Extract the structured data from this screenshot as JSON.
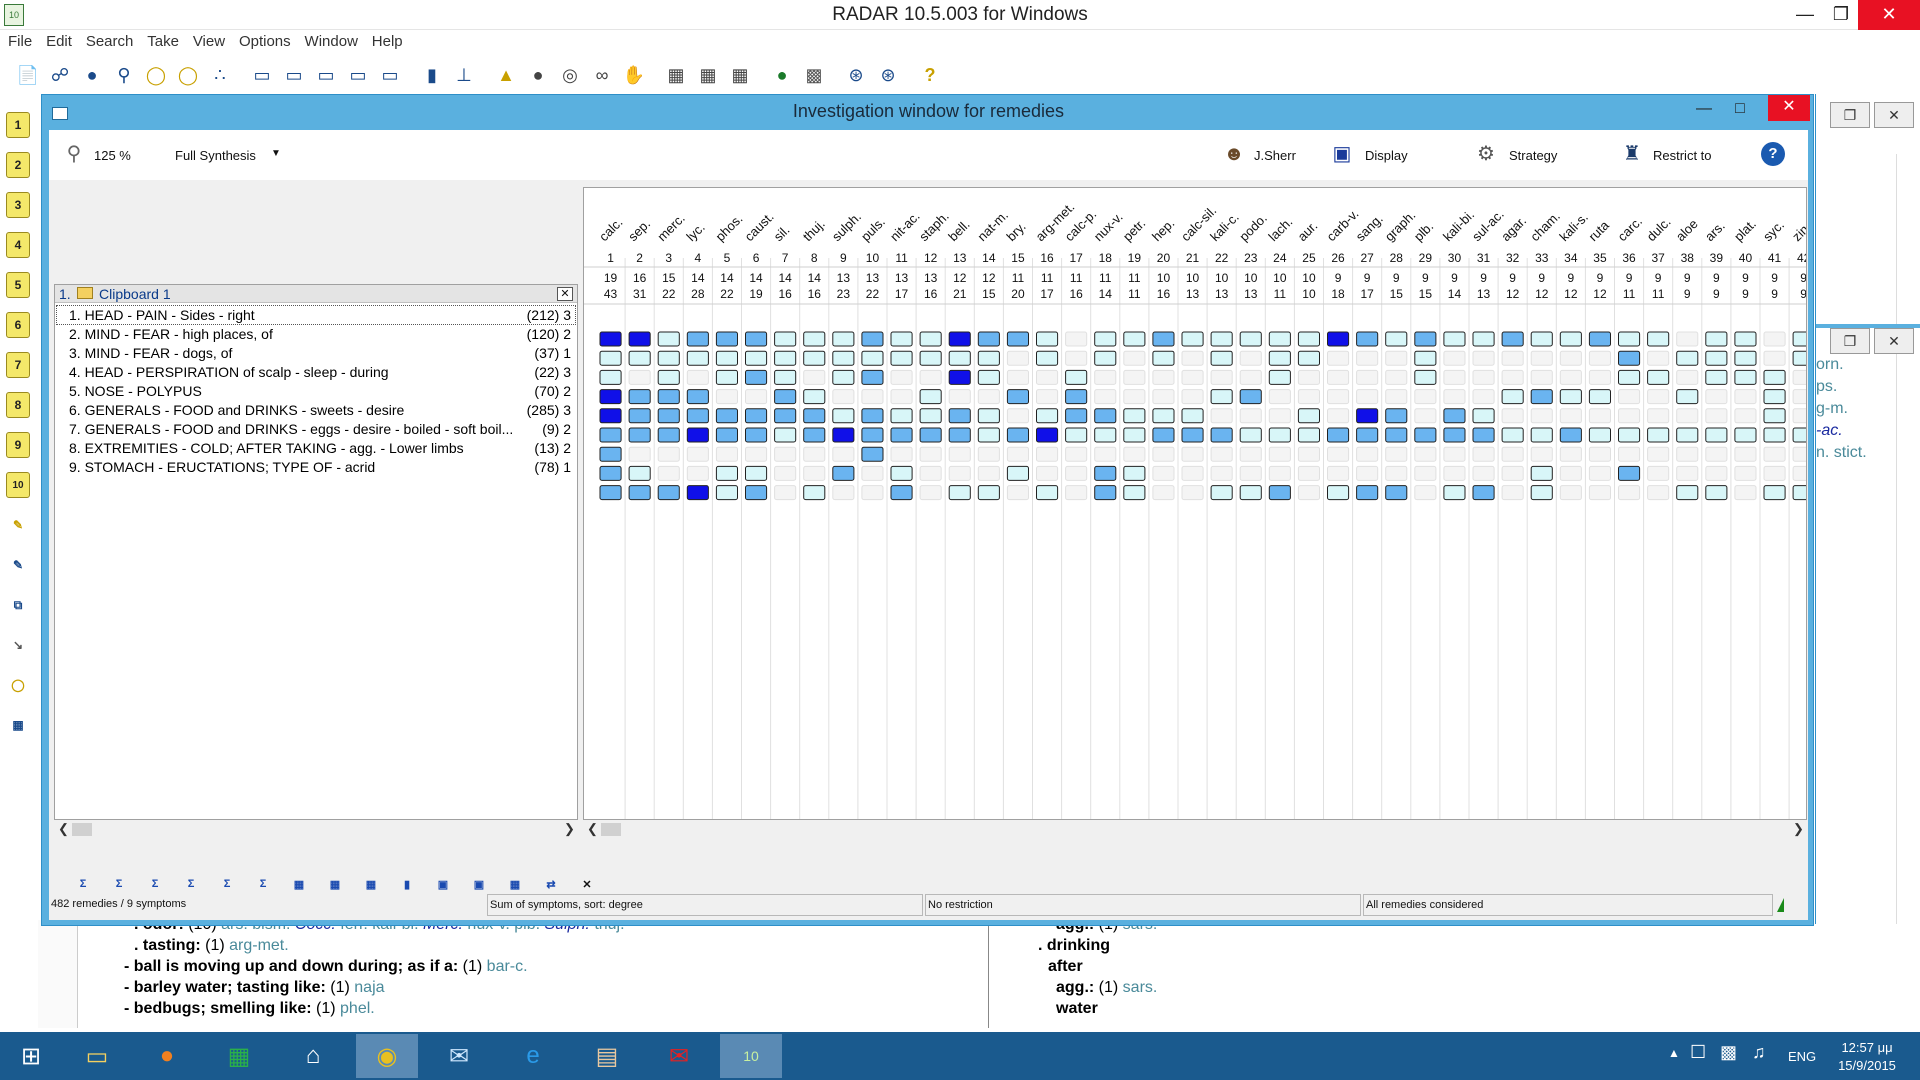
{
  "app": {
    "title": "RADAR 10.5.003 for Windows",
    "logo_text": "10 RADAR"
  },
  "menu": [
    "File",
    "Edit",
    "Search",
    "Take",
    "View",
    "Options",
    "Window",
    "Help"
  ],
  "toolbar_icons": [
    "open-icon",
    "binoculars-icon",
    "glasses-icon",
    "magnifier-icon",
    "bulb-icon",
    "bulb-plus-icon",
    "molecule-icon",
    "folder-icon",
    "folder-plus-icon",
    "folder-open-icon",
    "folder-edit-icon",
    "folder-star-icon",
    "bar-chart-icon",
    "tree-icon",
    "flame-icon",
    "shell-icon",
    "lifebuoy-icon",
    "spiral-icon",
    "hand-icon",
    "book-icon",
    "book-open-icon",
    "notes-icon",
    "globe-icon",
    "printer-icon",
    "network-icon",
    "network-plus-icon",
    "help-icon"
  ],
  "vtoolbar": [
    "1",
    "2",
    "3",
    "4",
    "5",
    "6",
    "7",
    "8",
    "9",
    "10"
  ],
  "investigation": {
    "title": "Investigation window for remedies",
    "zoom": "125 %",
    "method": "Full Synthesis",
    "author": "J.Sherr",
    "display_label": "Display",
    "strategy_label": "Strategy",
    "restrict_label": "Restrict to",
    "clipboard": {
      "number": "1.",
      "name": "Clipboard 1"
    },
    "symptoms": [
      {
        "text": "1. HEAD - PAIN - Sides - right",
        "count": "(212) 3"
      },
      {
        "text": "2. MIND - FEAR - high places, of",
        "count": "(120) 2"
      },
      {
        "text": "3. MIND - FEAR - dogs, of",
        "count": "(37) 1"
      },
      {
        "text": "4. HEAD - PERSPIRATION of scalp - sleep - during",
        "count": "(22) 3"
      },
      {
        "text": "5. NOSE - POLYPUS",
        "count": "(70) 2"
      },
      {
        "text": "6. GENERALS - FOOD and DRINKS - sweets - desire",
        "count": "(285) 3"
      },
      {
        "text": "7. GENERALS - FOOD and DRINKS - eggs - desire - boiled - soft boil...",
        "count": "(9) 2"
      },
      {
        "text": "8. EXTREMITIES - COLD; AFTER TAKING - agg. - Lower limbs",
        "count": "(13) 2"
      },
      {
        "text": "9. STOMACH - ERUCTATIONS; TYPE OF - acrid",
        "count": "(78) 1"
      }
    ],
    "remedies": [
      {
        "name": "calc.",
        "rank": "1",
        "s": "19",
        "d": "43"
      },
      {
        "name": "sep.",
        "rank": "2",
        "s": "16",
        "d": "31"
      },
      {
        "name": "merc.",
        "rank": "3",
        "s": "15",
        "d": "22"
      },
      {
        "name": "lyc.",
        "rank": "4",
        "s": "14",
        "d": "28"
      },
      {
        "name": "phos.",
        "rank": "5",
        "s": "14",
        "d": "22"
      },
      {
        "name": "caust.",
        "rank": "6",
        "s": "14",
        "d": "19"
      },
      {
        "name": "sil.",
        "rank": "7",
        "s": "14",
        "d": "16"
      },
      {
        "name": "thuj.",
        "rank": "8",
        "s": "14",
        "d": "16"
      },
      {
        "name": "sulph.",
        "rank": "9",
        "s": "13",
        "d": "23"
      },
      {
        "name": "puls.",
        "rank": "10",
        "s": "13",
        "d": "22"
      },
      {
        "name": "nit-ac.",
        "rank": "11",
        "s": "13",
        "d": "17"
      },
      {
        "name": "staph.",
        "rank": "12",
        "s": "13",
        "d": "16"
      },
      {
        "name": "bell.",
        "rank": "13",
        "s": "12",
        "d": "21"
      },
      {
        "name": "nat-m.",
        "rank": "14",
        "s": "12",
        "d": "15"
      },
      {
        "name": "bry.",
        "rank": "15",
        "s": "11",
        "d": "20"
      },
      {
        "name": "arg-met.",
        "rank": "16",
        "s": "11",
        "d": "17"
      },
      {
        "name": "calc-p.",
        "rank": "17",
        "s": "11",
        "d": "16"
      },
      {
        "name": "nux-v.",
        "rank": "18",
        "s": "11",
        "d": "14"
      },
      {
        "name": "petr.",
        "rank": "19",
        "s": "11",
        "d": "11"
      },
      {
        "name": "hep.",
        "rank": "20",
        "s": "10",
        "d": "16"
      },
      {
        "name": "calc-sil.",
        "rank": "21",
        "s": "10",
        "d": "13"
      },
      {
        "name": "kali-c.",
        "rank": "22",
        "s": "10",
        "d": "13"
      },
      {
        "name": "podo.",
        "rank": "23",
        "s": "10",
        "d": "13"
      },
      {
        "name": "lach.",
        "rank": "24",
        "s": "10",
        "d": "11"
      },
      {
        "name": "aur.",
        "rank": "25",
        "s": "10",
        "d": "10"
      },
      {
        "name": "carb-v.",
        "rank": "26",
        "s": "9",
        "d": "18"
      },
      {
        "name": "sang.",
        "rank": "27",
        "s": "9",
        "d": "17"
      },
      {
        "name": "graph.",
        "rank": "28",
        "s": "9",
        "d": "15"
      },
      {
        "name": "plb.",
        "rank": "29",
        "s": "9",
        "d": "15"
      },
      {
        "name": "kali-bi.",
        "rank": "30",
        "s": "9",
        "d": "14"
      },
      {
        "name": "sul-ac.",
        "rank": "31",
        "s": "9",
        "d": "13"
      },
      {
        "name": "agar.",
        "rank": "32",
        "s": "9",
        "d": "12"
      },
      {
        "name": "cham.",
        "rank": "33",
        "s": "9",
        "d": "12"
      },
      {
        "name": "kali-s.",
        "rank": "34",
        "s": "9",
        "d": "12"
      },
      {
        "name": "ruta",
        "rank": "35",
        "s": "9",
        "d": "12"
      },
      {
        "name": "carc.",
        "rank": "36",
        "s": "9",
        "d": "11"
      },
      {
        "name": "dulc.",
        "rank": "37",
        "s": "9",
        "d": "11"
      },
      {
        "name": "aloe",
        "rank": "38",
        "s": "9",
        "d": "9"
      },
      {
        "name": "ars.",
        "rank": "39",
        "s": "9",
        "d": "9"
      },
      {
        "name": "plat.",
        "rank": "40",
        "s": "9",
        "d": "9"
      },
      {
        "name": "syc.",
        "rank": "41",
        "s": "9",
        "d": "9"
      },
      {
        "name": "zin",
        "rank": "42",
        "s": "9",
        "d": "9"
      }
    ],
    "grades": [
      [
        3,
        3,
        1,
        2,
        2,
        2,
        1,
        1,
        1,
        2,
        1,
        1,
        3,
        2,
        2,
        1,
        0,
        1,
        1,
        2,
        1,
        1,
        1,
        1,
        1,
        3,
        2,
        1,
        2,
        1,
        1,
        2,
        1,
        1,
        2,
        1,
        1,
        0,
        1,
        1,
        0,
        1
      ],
      [
        1,
        1,
        1,
        1,
        1,
        1,
        1,
        1,
        1,
        1,
        1,
        1,
        1,
        1,
        0,
        1,
        0,
        1,
        0,
        1,
        0,
        1,
        0,
        1,
        1,
        0,
        0,
        0,
        1,
        0,
        0,
        0,
        0,
        0,
        0,
        2,
        0,
        1,
        1,
        1,
        0,
        1
      ],
      [
        1,
        0,
        1,
        0,
        1,
        2,
        1,
        0,
        1,
        2,
        0,
        0,
        3,
        1,
        0,
        0,
        1,
        0,
        0,
        0,
        0,
        0,
        0,
        1,
        0,
        0,
        0,
        0,
        1,
        0,
        0,
        0,
        0,
        0,
        0,
        1,
        1,
        0,
        1,
        1,
        1,
        0
      ],
      [
        3,
        2,
        2,
        2,
        0,
        0,
        2,
        1,
        0,
        0,
        0,
        1,
        0,
        0,
        2,
        0,
        2,
        0,
        0,
        0,
        0,
        1,
        2,
        0,
        0,
        0,
        0,
        0,
        0,
        0,
        0,
        1,
        2,
        1,
        1,
        0,
        0,
        1,
        0,
        0,
        1,
        0
      ],
      [
        3,
        2,
        2,
        2,
        2,
        2,
        2,
        2,
        1,
        2,
        1,
        1,
        2,
        1,
        0,
        1,
        2,
        2,
        1,
        1,
        1,
        0,
        0,
        0,
        1,
        0,
        3,
        2,
        0,
        2,
        1,
        0,
        0,
        0,
        0,
        0,
        0,
        0,
        0,
        0,
        1,
        0
      ],
      [
        2,
        2,
        2,
        3,
        2,
        2,
        1,
        2,
        3,
        2,
        2,
        2,
        2,
        1,
        2,
        3,
        1,
        1,
        1,
        2,
        2,
        2,
        1,
        1,
        1,
        2,
        2,
        2,
        2,
        2,
        2,
        1,
        1,
        2,
        1,
        1,
        1,
        1,
        1,
        1,
        1,
        1
      ],
      [
        2,
        0,
        0,
        0,
        0,
        0,
        0,
        0,
        0,
        2,
        0,
        0,
        0,
        0,
        0,
        0,
        0,
        0,
        0,
        0,
        0,
        0,
        0,
        0,
        0,
        0,
        0,
        0,
        0,
        0,
        0,
        0,
        0,
        0,
        0,
        0,
        0,
        0,
        0,
        0,
        0,
        0
      ],
      [
        2,
        1,
        0,
        0,
        1,
        1,
        0,
        0,
        2,
        0,
        1,
        0,
        0,
        0,
        1,
        0,
        0,
        2,
        1,
        0,
        0,
        0,
        0,
        0,
        0,
        0,
        0,
        0,
        0,
        0,
        0,
        0,
        1,
        0,
        0,
        2,
        0,
        0,
        0,
        0,
        0,
        0
      ],
      [
        2,
        2,
        2,
        3,
        1,
        2,
        0,
        1,
        0,
        0,
        2,
        0,
        1,
        1,
        0,
        1,
        0,
        2,
        1,
        0,
        0,
        1,
        1,
        2,
        0,
        1,
        2,
        2,
        0,
        1,
        2,
        0,
        1,
        0,
        0,
        0,
        0,
        1,
        1,
        0,
        1,
        1
      ]
    ],
    "colors": {
      "grade0": "#f4f4f4",
      "grade1": "#d8f6f8",
      "grade2": "#6ab4f0",
      "grade3": "#1010e8"
    },
    "bottom_tools": [
      "Σ",
      "Σ",
      "Σ",
      "Σ",
      "Σ",
      "Σ",
      "▦",
      "▦",
      "▦",
      "▮",
      "▣",
      "▣",
      "▦",
      "⇄",
      "✕"
    ],
    "status": {
      "count": "482 remedies / 9 symptoms",
      "sort": "Sum of symptoms, sort: degree",
      "restriction": "No restriction",
      "considered": "All remedies considered"
    }
  },
  "background_doc": {
    "left": [
      {
        "label": ". odor:",
        "count": "(10)",
        "rems": [
          "ars.",
          "bism.",
          "Cocc.",
          "ferr.",
          "kali-bi.",
          "Merc.",
          "nux-v.",
          "plb.",
          "Sulph.",
          "thuj."
        ]
      },
      {
        "label": ". tasting:",
        "count": "(1)",
        "rems": [
          "arg-met."
        ]
      },
      {
        "label": "- ball is moving up and down during; as if a:",
        "count": "(1)",
        "rems": [
          "bar-c."
        ]
      },
      {
        "label": "- barley water; tasting like:",
        "count": "(1)",
        "rems": [
          "naja"
        ]
      },
      {
        "label": "- bedbugs; smelling like:",
        "count": "(1)",
        "rems": [
          "phel."
        ]
      }
    ],
    "right": [
      {
        "label": "agg.:",
        "count": "(1)",
        "rems": [
          "sars."
        ]
      },
      {
        "label": ". drinking",
        "count": "",
        "rems": []
      },
      {
        "label": "after",
        "count": "",
        "rems": []
      },
      {
        "label": "agg.:",
        "count": "(1)",
        "rems": [
          "sars."
        ]
      },
      {
        "label": "water",
        "count": "",
        "rems": []
      }
    ],
    "right_window_rems": [
      "orn.",
      "ps.",
      "g-m.",
      "-ac.",
      "n. stict."
    ]
  },
  "taskbar": {
    "lang": "ENG",
    "time": "12:57 μμ",
    "date": "15/9/2015"
  }
}
